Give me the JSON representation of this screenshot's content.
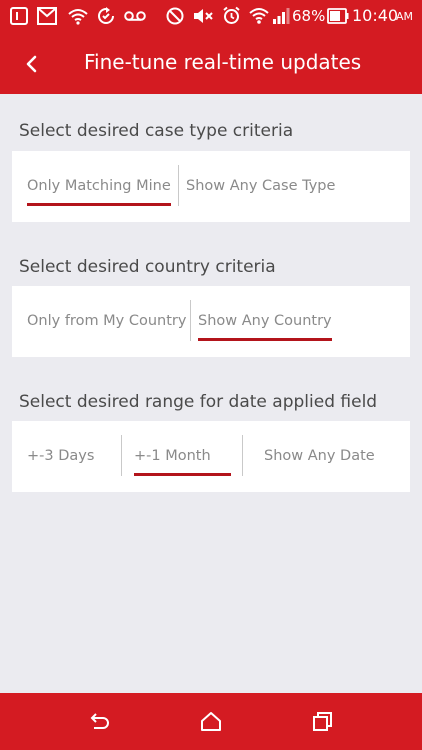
{
  "status_bar": {
    "battery_percent": "68%",
    "time": "10:40",
    "time_suffix": "AM"
  },
  "header": {
    "title": "Fine-tune real-time updates"
  },
  "sections": [
    {
      "title": "Select desired case type criteria",
      "options": [
        {
          "label": "Only Matching Mine",
          "selected": true
        },
        {
          "label": "Show Any Case Type",
          "selected": false
        }
      ]
    },
    {
      "title": "Select desired country criteria",
      "options": [
        {
          "label": "Only from My Country",
          "selected": false
        },
        {
          "label": "Show Any Country",
          "selected": true
        }
      ]
    },
    {
      "title": "Select desired range for date applied field",
      "options": [
        {
          "label": "+-3 Days",
          "selected": false
        },
        {
          "label": "+-1 Month",
          "selected": true
        },
        {
          "label": "Show Any Date",
          "selected": false
        }
      ]
    }
  ],
  "colors": {
    "accent": "#d41b22",
    "underline": "#b3141b",
    "background": "#ebebf0"
  }
}
